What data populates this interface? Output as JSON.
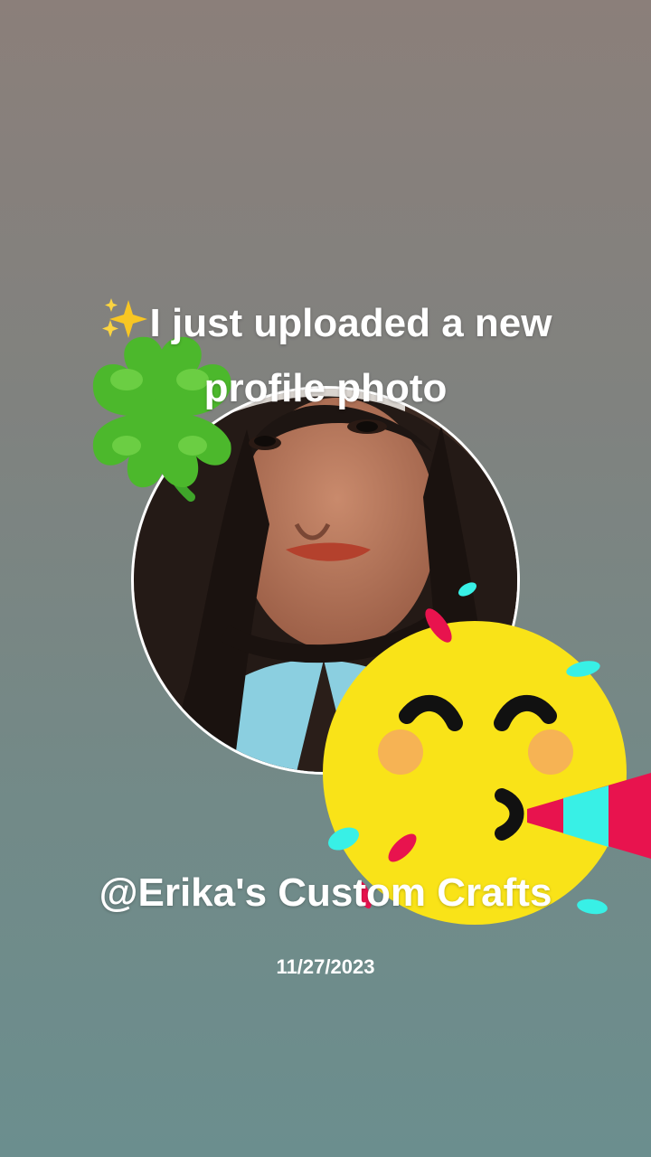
{
  "post": {
    "headline": "I just uploaded a new profile photo",
    "handle": "@Erika's Custom Crafts",
    "date": "11/27/2023"
  },
  "decorations": {
    "sparkle": "sparkles-icon",
    "clover": "four-leaf-clover-icon",
    "party": "party-face-icon"
  },
  "colors": {
    "text": "#ffffff",
    "clover_green": "#4caf2a",
    "party_yellow": "#f9e318",
    "party_cheek": "#f6b354",
    "horn_red": "#e8134e",
    "horn_teal": "#38f0e6"
  }
}
